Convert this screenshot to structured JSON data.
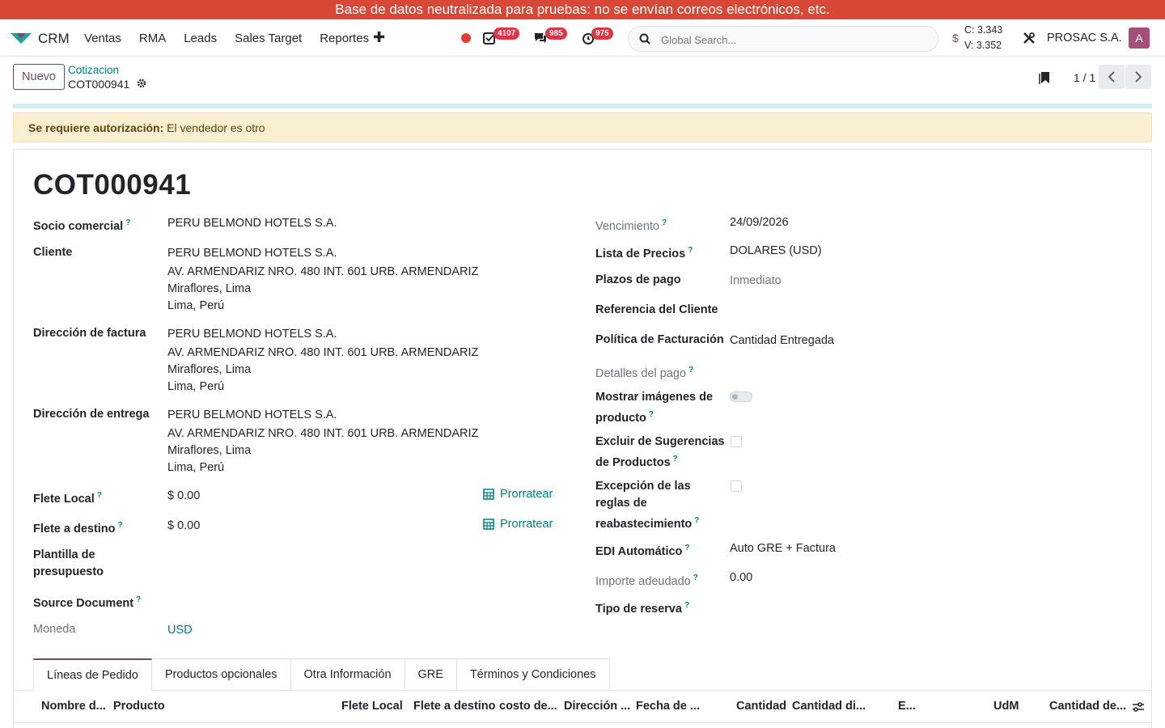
{
  "banner": "Base de datos neutralizada para pruebas: no se envían correos electrónicos, etc.",
  "navbar": {
    "app_name": "CRM",
    "menu": [
      "Ventas",
      "RMA",
      "Leads",
      "Sales Target",
      "Reportes"
    ],
    "badges": {
      "activities": "4107",
      "messages": "985",
      "timers": "975"
    },
    "search_placeholder": "Global Search...",
    "currency_symbol": "$",
    "rate_c": "C: 3.343",
    "rate_v": "V: 3.352",
    "company": "PROSAC S.A.",
    "avatar_letter": "A"
  },
  "control": {
    "new_button": "Nuevo",
    "breadcrumb_parent": "Cotizacion",
    "breadcrumb_current": "COT000941",
    "pager": "1 / 1"
  },
  "alert": {
    "title": "Se requiere autorización:",
    "message": "El vendedor es otro"
  },
  "form": {
    "title": "COT000941",
    "left": {
      "socio_label": "Socio comercial",
      "socio_value": "PERU BELMOND HOTELS S.A.",
      "cliente_label": "Cliente",
      "cliente_lines": [
        "PERU BELMOND HOTELS S.A.",
        "AV. ARMENDARIZ NRO. 480 INT. 601 URB. ARMENDARIZ",
        "Miraflores, Lima",
        "Lima, Perú"
      ],
      "factura_label": "Dirección de factura",
      "factura_lines": [
        "PERU BELMOND HOTELS S.A.",
        "AV. ARMENDARIZ NRO. 480 INT. 601 URB. ARMENDARIZ",
        "Miraflores, Lima",
        "Lima, Perú"
      ],
      "entrega_label": "Dirección de entrega",
      "entrega_lines": [
        "PERU BELMOND HOTELS S.A.",
        "AV. ARMENDARIZ NRO. 480 INT. 601 URB. ARMENDARIZ",
        "Miraflores, Lima",
        "Lima, Perú"
      ],
      "flete_local_label": "Flete Local",
      "flete_local_value": "$ 0.00",
      "flete_destino_label": "Flete a destino",
      "flete_destino_value": "$ 0.00",
      "prorratear": "Prorratear",
      "plantilla_label_1": "Plantilla de",
      "plantilla_label_2": "presupuesto",
      "source_label": "Source Document",
      "moneda_label": "Moneda",
      "moneda_value": "USD"
    },
    "right": {
      "vencimiento_label": "Vencimiento",
      "vencimiento_value": "24/09/2026",
      "lista_label": "Lista de Precios",
      "lista_value": "DOLARES (USD)",
      "plazos_label": "Plazos de pago",
      "plazos_value": "Inmediato",
      "referencia_label": "Referencia del Cliente",
      "politica_label": "Política de Facturación",
      "politica_value": "Cantidad Entregada",
      "detalles_label": "Detalles del pago",
      "mostrar_label_1": "Mostrar imágenes de",
      "mostrar_label_2": "producto",
      "excluir_label_1": "Excluir de Sugerencias",
      "excluir_label_2": "de Productos",
      "excepcion_label_1": "Excepción de las",
      "excepcion_label_2": "reglas de",
      "excepcion_label_3": "reabastecimiento",
      "edi_label": "EDI Automático",
      "edi_value": "Auto GRE + Factura",
      "importe_label": "Importe adeudado",
      "importe_value": "0.00",
      "reserva_label": "Tipo de reserva"
    },
    "help_mark": "?",
    "mostrar_imagenes": false,
    "excluir_sugerencias": false,
    "excepcion_reglas": false
  },
  "tabs": [
    "Líneas de Pedido",
    "Productos opcionales",
    "Otra Información",
    "GRE",
    "Términos y Condiciones"
  ],
  "columns": [
    "Nombre d...",
    "Producto",
    "Flete Local",
    "Flete a destino",
    "costo de...",
    "Dirección ...",
    "Fecha de ...",
    "Cantidad",
    "Cantidad di...",
    "E...",
    "UdM",
    "Cantidad de..."
  ]
}
